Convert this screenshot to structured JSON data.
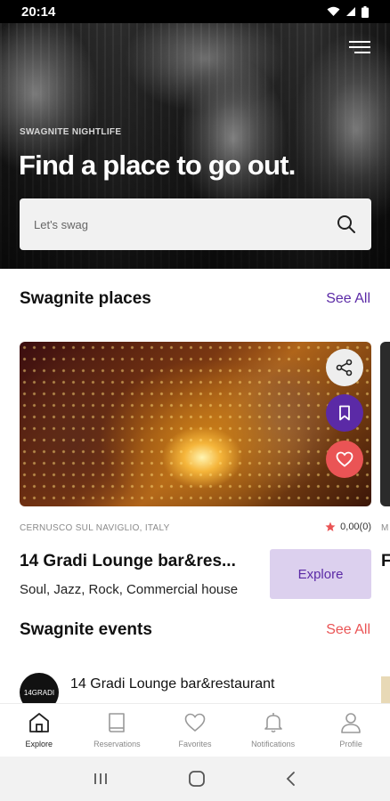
{
  "status_bar": {
    "time": "20:14"
  },
  "hero": {
    "eyebrow": "SWAGNITE NIGHTLIFE",
    "title": "Find a place to go out.",
    "search_placeholder": "Let's swag"
  },
  "places_section": {
    "title": "Swagnite places",
    "see_all": "See All",
    "see_all_color": "#5b2aa6"
  },
  "place_card": {
    "location": "CERNUSCO SUL NAVIGLIO, ITALY",
    "rating": "0,00(0)",
    "name": "14 Gradi Lounge bar&res...",
    "tags": "Soul, Jazz, Rock, Commercial house",
    "explore_label": "Explore",
    "next_card_location_peek": "M",
    "next_card_name_peek": "F"
  },
  "events_section": {
    "title": "Swagnite events",
    "see_all": "See All",
    "see_all_color": "#ea5455"
  },
  "event_item": {
    "avatar_text": "14GRADI",
    "name": "14 Gradi Lounge bar&restaurant"
  },
  "bottom_nav": [
    {
      "label": "Explore",
      "icon": "home-icon",
      "active": true
    },
    {
      "label": "Reservations",
      "icon": "book-icon",
      "active": false
    },
    {
      "label": "Favorites",
      "icon": "heart-icon",
      "active": false
    },
    {
      "label": "Notifications",
      "icon": "bell-icon",
      "active": false
    },
    {
      "label": "Profile",
      "icon": "profile-icon",
      "active": false
    }
  ],
  "colors": {
    "accent_purple": "#5b2aa6",
    "accent_red": "#ea5455",
    "explore_bg": "#dcd0ee"
  }
}
